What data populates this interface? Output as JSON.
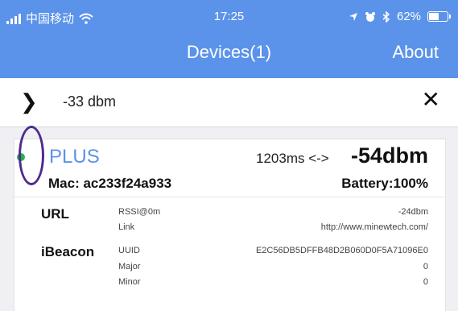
{
  "status_bar": {
    "carrier": "中国移动",
    "time": "17:25",
    "battery": "62%",
    "battery_level": 0.62
  },
  "nav": {
    "title": "Devices(1)",
    "about": "About"
  },
  "filter": {
    "rssi_filter": "-33 dbm"
  },
  "device": {
    "name": "PLUS",
    "interval": "1203ms <->",
    "rssi": "-54dbm",
    "mac": "Mac: ac233f24a933",
    "battery": "Battery:100%",
    "colors": {
      "name": "#5b93ea",
      "online_dot": "#27b34a",
      "annotation_ring": "#4e2a8e"
    },
    "sections": [
      {
        "title": "URL",
        "rows": [
          {
            "key": "RSSI@0m",
            "value": "-24dbm"
          },
          {
            "key": "Link",
            "value": "http://www.minewtech.com/"
          }
        ]
      },
      {
        "title": "iBeacon",
        "rows": [
          {
            "key": "UUID",
            "value": "E2C56DB5DFFB48D2B060D0F5A71096E0"
          },
          {
            "key": "Major",
            "value": "0"
          },
          {
            "key": "Minor",
            "value": "0"
          }
        ]
      }
    ]
  }
}
